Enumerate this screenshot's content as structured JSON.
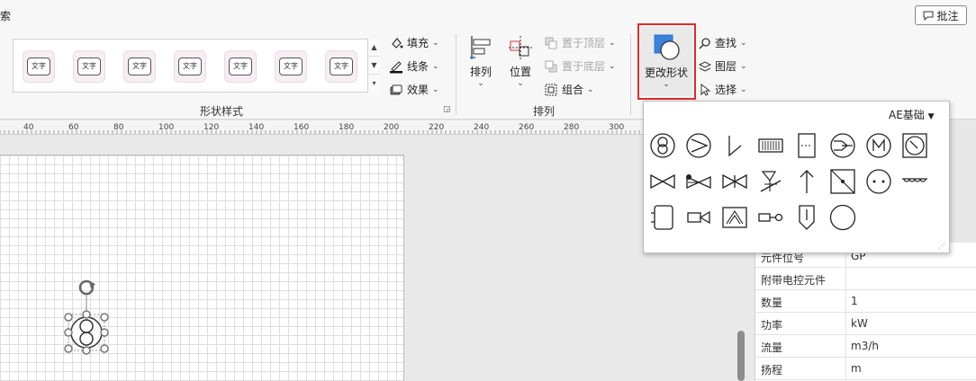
{
  "ribbon": {
    "partial_left_char": "索",
    "comment_button": "批注",
    "shape_styles": {
      "group_label": "形状样式",
      "swatch_text": "文字",
      "fill": "填充",
      "line": "线条",
      "effect": "效果"
    },
    "arrange": {
      "group_label": "排列",
      "arrange_btn": "排列",
      "position_btn": "位置",
      "bring_front": "置于顶层",
      "send_back": "置于底层",
      "group": "组合"
    },
    "change_shape": "更改形状",
    "find": "查找",
    "layer": "图层",
    "select": "选择"
  },
  "ruler": {
    "ticks": [
      "40",
      "60",
      "80",
      "100",
      "120",
      "140",
      "160",
      "180",
      "200",
      "220",
      "240",
      "260",
      "280",
      "300"
    ]
  },
  "dropdown": {
    "category": "AE基础"
  },
  "properties": [
    {
      "key": "元件位号",
      "value": "GP"
    },
    {
      "key": "附带电控元件",
      "value": ""
    },
    {
      "key": "数量",
      "value": "1"
    },
    {
      "key": "功率",
      "value": "kW"
    },
    {
      "key": "流量",
      "value": "m3/h"
    },
    {
      "key": "扬程",
      "value": "m"
    }
  ],
  "colors": {
    "highlight": "#e12b2b",
    "accent": "#2f6fd6"
  }
}
